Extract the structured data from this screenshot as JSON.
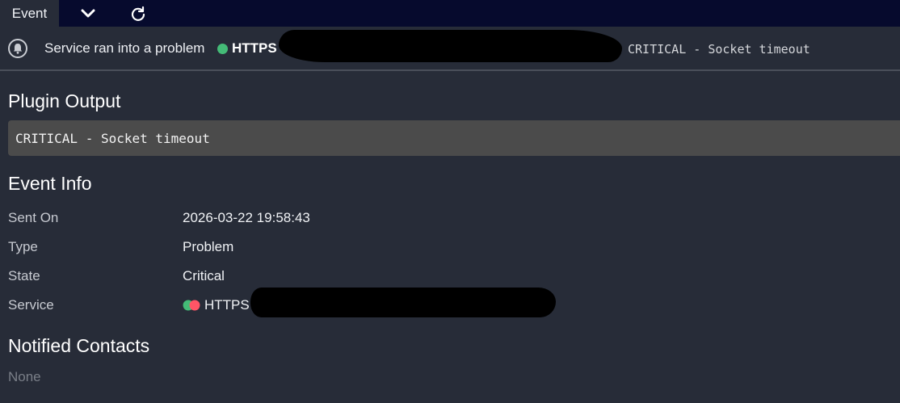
{
  "tabs": {
    "event_label": "Event",
    "dropdown_icon": "chevron-down-icon",
    "refresh_icon": "refresh-icon"
  },
  "header": {
    "bell_icon": "bell-icon",
    "title": "Service ran into a problem",
    "service_name": "HTTPS",
    "status_color": "#44bb77",
    "output_text": "CRITICAL - Socket timeout"
  },
  "plugin_output": {
    "title": "Plugin Output",
    "text": "CRITICAL - Socket timeout"
  },
  "event_info": {
    "title": "Event Info",
    "rows": [
      {
        "label": "Sent On",
        "value": "2026-03-22 19:58:43"
      },
      {
        "label": "Type",
        "value": "Problem"
      },
      {
        "label": "State",
        "value": "Critical"
      },
      {
        "label": "Service",
        "value": "HTTPS"
      }
    ],
    "service_dot_colors": [
      "#44bb77",
      "#ff5566"
    ]
  },
  "notified_contacts": {
    "title": "Notified Contacts",
    "value": "None"
  },
  "colors": {
    "background": "#272c38",
    "tabbar": "#060a2d",
    "code_box": "#4b4b4b"
  }
}
